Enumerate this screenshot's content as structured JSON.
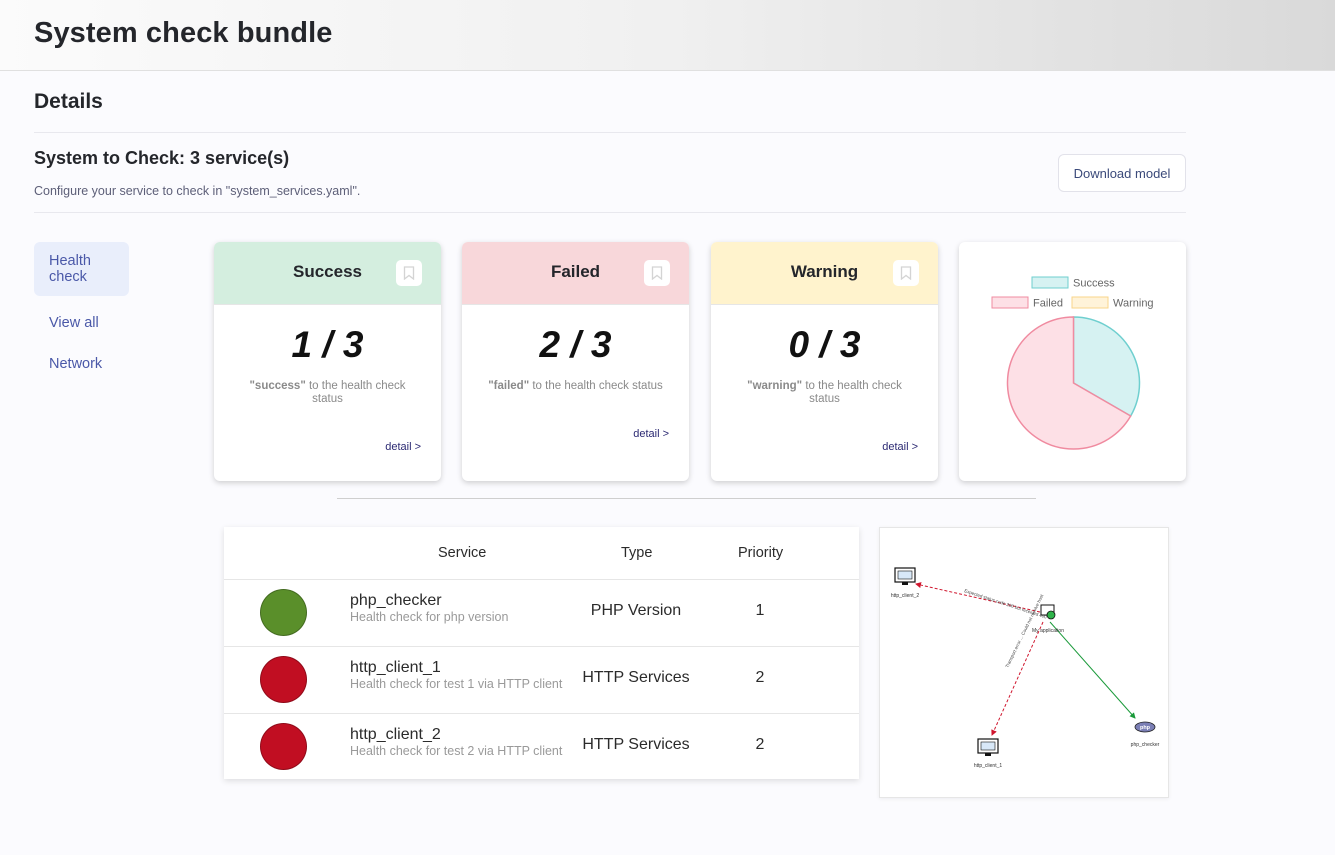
{
  "app": {
    "title": "System check bundle"
  },
  "details": {
    "title": "Details"
  },
  "system": {
    "title": "System to Check: 3 service(s)",
    "subtitle": "Configure your service to check in \"system_services.yaml\".",
    "download_label": "Download model"
  },
  "nav": {
    "items": [
      {
        "label": "Health check",
        "active": true
      },
      {
        "label": "View all",
        "active": false
      },
      {
        "label": "Network",
        "active": false
      }
    ]
  },
  "cards": [
    {
      "title": "Success",
      "value": "1 / 3",
      "keyword": "\"success\"",
      "desc_rest": " to the health check status",
      "link": "detail >",
      "color": "#d4eedf"
    },
    {
      "title": "Failed",
      "value": "2 / 3",
      "keyword": "\"failed\"",
      "desc_rest": " to the health check status",
      "link": "detail >",
      "color": "#f8d7da"
    },
    {
      "title": "Warning",
      "value": "0 / 3",
      "keyword": "\"warning\"",
      "desc_rest": " to the health check status",
      "link": "detail >",
      "color": "#fff3cd"
    }
  ],
  "chart_data": {
    "type": "pie",
    "legend": [
      {
        "label": "Success",
        "fill": "#d6f2f2",
        "stroke": "#6fcfcf"
      },
      {
        "label": "Failed",
        "fill": "#fde0e6",
        "stroke": "#f08ba0"
      },
      {
        "label": "Warning",
        "fill": "#fff3d9",
        "stroke": "#f8d48a"
      }
    ],
    "values": [
      1,
      2,
      0
    ],
    "legend_position": "top"
  },
  "table": {
    "headers": {
      "service": "Service",
      "type": "Type",
      "priority": "Priority"
    },
    "rows": [
      {
        "name": "php_checker",
        "desc": "Health check for php version",
        "type": "PHP Version",
        "priority": "1",
        "status_color": "#5a8f2a"
      },
      {
        "name": "http_client_1",
        "desc": "Health check for test 1 via HTTP client",
        "type": "HTTP Services",
        "priority": "2",
        "status_color": "#c10e22"
      },
      {
        "name": "http_client_2",
        "desc": "Health check for test 2 via HTTP client",
        "type": "HTTP Services",
        "priority": "2",
        "status_color": "#c10e22"
      }
    ]
  },
  "network": {
    "nodes": {
      "center": "My application",
      "n1": "http_client_2",
      "n2": "http_client_1",
      "n3": "php_checker"
    },
    "edges": {
      "e1": "Expected status code 200 but received 400",
      "e2": "Transport error ... Could not resolve host",
      "e3": ""
    }
  }
}
